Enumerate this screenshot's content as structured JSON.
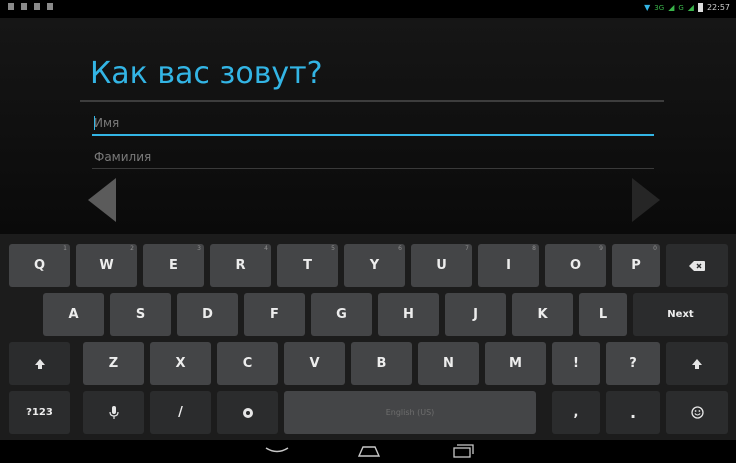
{
  "status_bar": {
    "left_icons": [
      "notification-icon",
      "signal-icon",
      "alert-icon",
      "sim-icon"
    ],
    "network_label": "3G",
    "network_label_2": "G",
    "time": "22:57"
  },
  "setup": {
    "title": "Как вас зовут?",
    "first_name_placeholder": "Имя",
    "last_name_placeholder": "Фамилия",
    "accent_color": "#33b5e5"
  },
  "keyboard": {
    "row1": [
      {
        "label": "Q",
        "hint": "1"
      },
      {
        "label": "W",
        "hint": "2"
      },
      {
        "label": "E",
        "hint": "3"
      },
      {
        "label": "R",
        "hint": "4"
      },
      {
        "label": "T",
        "hint": "5"
      },
      {
        "label": "Y",
        "hint": "6"
      },
      {
        "label": "U",
        "hint": "7"
      },
      {
        "label": "I",
        "hint": "8"
      },
      {
        "label": "O",
        "hint": "9"
      },
      {
        "label": "P",
        "hint": "0"
      }
    ],
    "backspace_icon": "backspace-icon",
    "row2": [
      "A",
      "S",
      "D",
      "F",
      "G",
      "H",
      "J",
      "K",
      "L"
    ],
    "next_label": "Next",
    "row3": [
      "Z",
      "X",
      "C",
      "V",
      "B",
      "N",
      "M",
      "!",
      "?"
    ],
    "shift_icon": "shift-icon",
    "symbols_label": "?123",
    "mic_icon": "microphone-icon",
    "slash_label": "/",
    "settings_icon": "settings-icon",
    "space_label": "English (US)",
    "comma_label": ",",
    "period_label": ".",
    "emoji_icon": "emoji-icon"
  },
  "nav_bar": {
    "back_icon": "back-icon",
    "home_icon": "home-icon",
    "recents_icon": "recents-icon"
  }
}
